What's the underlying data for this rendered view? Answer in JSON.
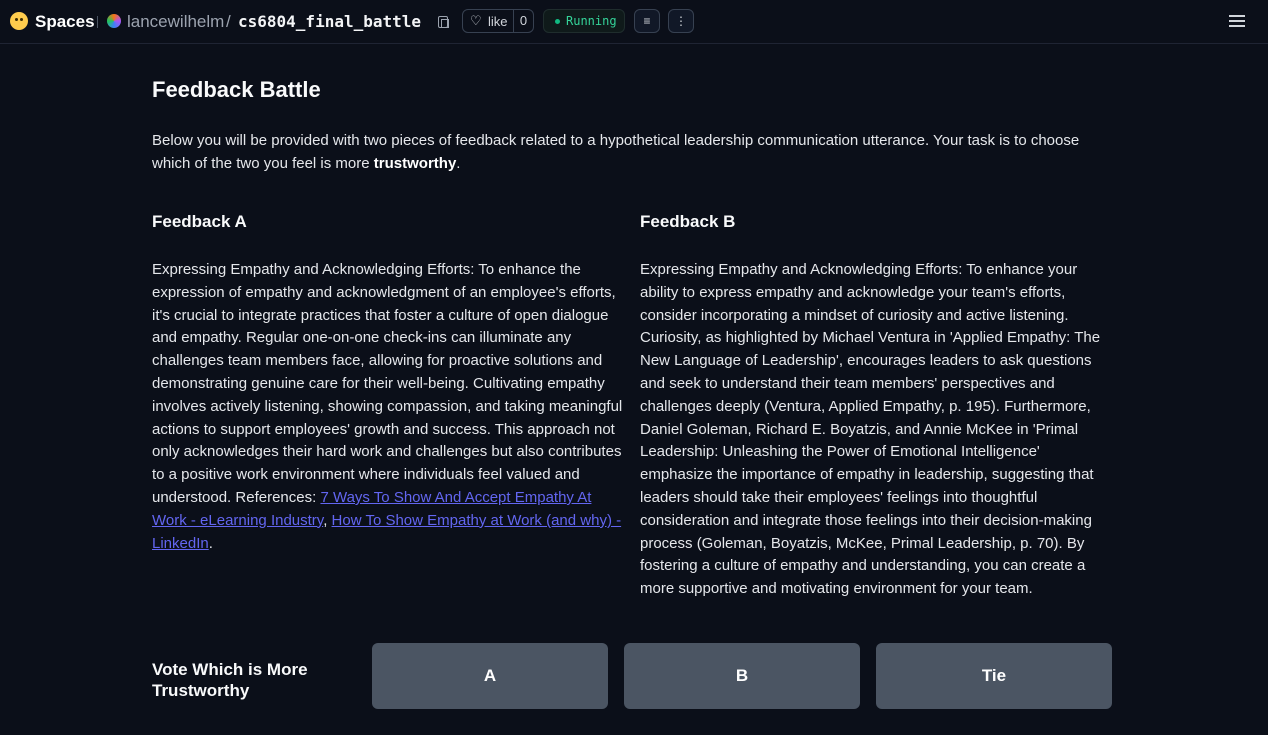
{
  "header": {
    "brand": "Spaces",
    "owner": "lancewilhelm",
    "separator": "/",
    "repo": "cs6804_final_battle",
    "like_label": "like",
    "like_count": "0",
    "status": "Running",
    "status_color": "#10b981"
  },
  "page": {
    "title": "Feedback Battle",
    "intro_text": "Below you will be provided with two pieces of feedback related to a hypothetical leadership communication utterance. Your task is to choose which of the two you feel is more ",
    "intro_bold": "trustworthy",
    "intro_end": "."
  },
  "feedback_a": {
    "heading": "Feedback A",
    "body": "Expressing Empathy and Acknowledging Efforts: To enhance the expression of empathy and acknowledgment of an employee's efforts, it's crucial to integrate practices that foster a culture of open dialogue and empathy. Regular one-on-one check-ins can illuminate any challenges team members face, allowing for proactive solutions and demonstrating genuine care for their well-being. Cultivating empathy involves actively listening, showing compassion, and taking meaningful actions to support employees' growth and success. This approach not only acknowledges their hard work and challenges but also contributes to a positive work environment where individuals feel valued and understood.",
    "refs_label": "References: ",
    "link1": "7 Ways To Show And Accept Empathy At Work - eLearning Industry",
    "refs_sep": ", ",
    "link2": "How To Show Empathy at Work (and why) - LinkedIn",
    "refs_end": "."
  },
  "feedback_b": {
    "heading": "Feedback B",
    "body": "Expressing Empathy and Acknowledging Efforts: To enhance your ability to express empathy and acknowledge your team's efforts, consider incorporating a mindset of curiosity and active listening. Curiosity, as highlighted by Michael Ventura in 'Applied Empathy: The New Language of Leadership', encourages leaders to ask questions and seek to understand their team members' perspectives and challenges deeply (Ventura, Applied Empathy, p. 195). Furthermore, Daniel Goleman, Richard E. Boyatzis, and Annie McKee in 'Primal Leadership: Unleashing the Power of Emotional Intelligence' emphasize the importance of empathy in leadership, suggesting that leaders should take their employees' feelings into thoughtful consideration and integrate those feelings into their decision-making process (Goleman, Boyatzis, McKee, Primal Leadership, p. 70). By fostering a culture of empathy and understanding, you can create a more supportive and motivating environment for your team."
  },
  "vote": {
    "label": "Vote Which is More Trustworthy",
    "buttons": [
      "A",
      "B",
      "Tie"
    ]
  }
}
